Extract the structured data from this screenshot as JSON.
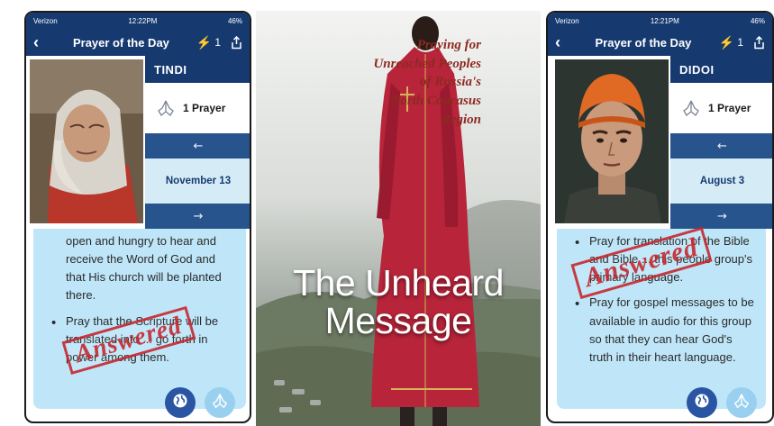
{
  "left_phone": {
    "status": {
      "carrier": "Verizon",
      "time": "12:22PM",
      "battery": "46%"
    },
    "nav": {
      "title": "Prayer of the Day",
      "streak": "1"
    },
    "people_group": "TINDI",
    "prayer_count": "1 Prayer",
    "date": "November 13",
    "card": {
      "text_top": "open and hungry to hear and receive the Word of God and that His church will be planted there.",
      "bullet": "Pray that the Scripture will be translated into ... go forth in power among them."
    },
    "stamp": "Answered"
  },
  "right_phone": {
    "status": {
      "carrier": "Verizon",
      "time": "12:21PM",
      "battery": "46%"
    },
    "nav": {
      "title": "Prayer of the Day",
      "streak": "1"
    },
    "people_group": "DIDOI",
    "prayer_count": "1 Prayer",
    "date": "August 3",
    "card": {
      "bullet_1": "Pray for translation of the Bible and Bible ... this people group's primary language.",
      "bullet_2": "Pray for gospel messages to be available in audio for this group so that they can hear God's truth in their heart language."
    },
    "stamp": "Answered"
  },
  "poster": {
    "tagline_lines": [
      "Praying for",
      "Unreached Peoples",
      "of Russia's",
      "North Caucasus",
      "Region"
    ],
    "headline_line1": "The Unheard",
    "headline_line2": "Message"
  },
  "colors": {
    "nav_blue": "#163a70",
    "arrow_blue": "#27548d",
    "card_blue": "#bfe6f8",
    "stamp_red": "#c8242b",
    "tagline_red": "#8d2a22"
  },
  "icons": [
    "back-chevron-icon",
    "bolt-icon",
    "share-icon",
    "praying-hands-icon",
    "arrow-left-icon",
    "arrow-right-icon",
    "globe-icon"
  ]
}
